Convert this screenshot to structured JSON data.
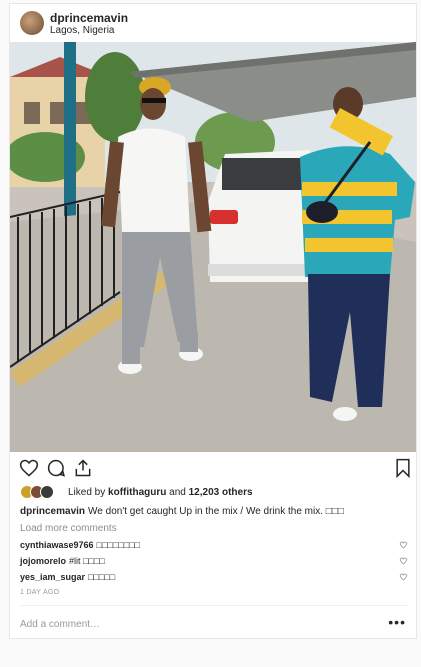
{
  "post": {
    "username": "dprincemavin",
    "location": "Lagos, Nigeria",
    "photo_alt_icon": "photo-two-men-driveway"
  },
  "actions": {
    "like_icon": "heart-icon",
    "comment_icon": "comment-icon",
    "share_icon": "share-icon",
    "save_icon": "bookmark-icon"
  },
  "likes": {
    "prefix": "Liked by",
    "user": "koffithaguru",
    "and": "and",
    "others": "12,203 others"
  },
  "caption": {
    "username": "dprincemavin",
    "text": "We don't get caught Up in the mix / We drink the mix. □□□"
  },
  "load_more": "Load more comments",
  "comments": [
    {
      "user": "cynthiawase9766",
      "text": "□□□□□□□□"
    },
    {
      "user": "jojomorelo",
      "text": "#lit □□□□"
    },
    {
      "user": "yes_iam_sugar",
      "text": "□□□□□"
    }
  ],
  "timestamp": "1 DAY AGO",
  "add_comment_placeholder": "Add a comment…",
  "more_options": "•••",
  "colors": {
    "text": "#262626",
    "muted": "#8e8e8e",
    "border": "#e6e6e6",
    "background": "#fafafa"
  }
}
